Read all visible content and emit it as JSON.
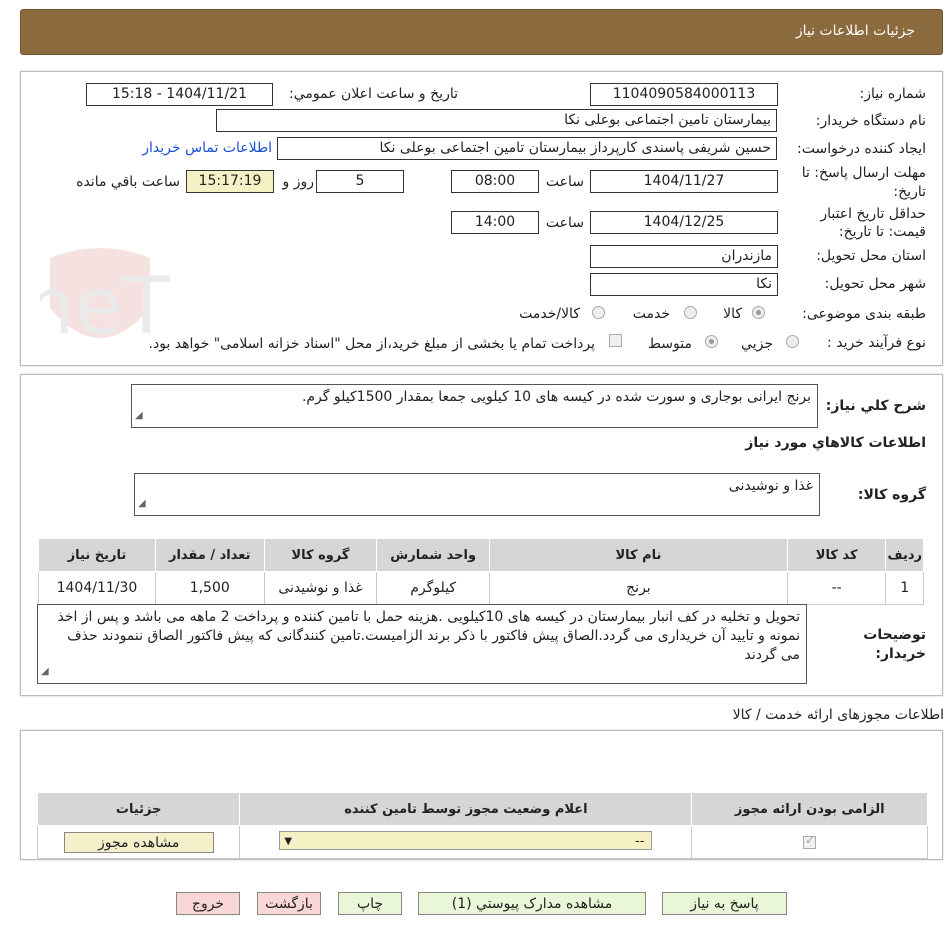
{
  "header_title": "جزئیات اطلاعات نیاز",
  "watermark": "AriaTender.neT",
  "fields": {
    "need_number_label": "شماره نیاز:",
    "need_number": "1104090584000113",
    "announce_label": "تاریخ و ساعت اعلان عمومي:",
    "announce_value": "1404/11/21 - 15:18",
    "buyer_label": "نام دستگاه خریدار:",
    "buyer_value": "بیمارستان تامین اجتماعی بوعلی نکا",
    "creator_label": "ایجاد کننده درخواست:",
    "creator_value": "حسین شریفی پاسندی کارپرداز بیمارستان تامین اجتماعی بوعلی نکا",
    "contact_link": "اطلاعات تماس خریدار",
    "deadline_label_1": "مهلت ارسال پاسخ: تا",
    "deadline_label_2": "تاریخ:",
    "deadline_date": "1404/11/27",
    "time_label": "ساعت",
    "deadline_time": "08:00",
    "days_value": "5",
    "days_label": "روز و",
    "remaining_time": "15:17:19",
    "remaining_label": "ساعت باقي مانده",
    "validity_label_1": "حداقل تاریخ اعتبار",
    "validity_label_2": "قیمت: تا تاریخ:",
    "validity_date": "1404/12/25",
    "validity_time": "14:00",
    "province_label": "استان محل تحویل:",
    "province_value": "مازندران",
    "city_label": "شهر محل تحویل:",
    "city_value": "نکا",
    "category_label": "طبقه بندی موضوعی:",
    "category_options": [
      "کالا",
      "خدمت",
      "کالا/خدمت"
    ],
    "process_label": "نوع فرآیند خرید :",
    "process_options": [
      "جزیي",
      "متوسط"
    ],
    "payment_note": "پرداخت تمام یا بخشی از مبلغ خرید،از محل \"اسناد خزانه اسلامی\" خواهد بود."
  },
  "summary": {
    "label": "شرح كلي نياز:",
    "text": "برنج ایرانی بوجاری و سورت شده در کیسه های 10 کیلویی جمعا بمقدار 1500کیلو گرم.",
    "goods_info_title": "اطلاعات کالاهاي مورد نياز",
    "group_label": "گروه کالا:",
    "group_value": "غذا و نوشیدنی"
  },
  "goods_table": {
    "headers": [
      "ردیف",
      "کد کالا",
      "نام کالا",
      "واحد شمارش",
      "گروه کالا",
      "تعداد / مقدار",
      "تاریخ نیاز"
    ],
    "rows": [
      [
        "1",
        "--",
        "برنج",
        "کیلوگرم",
        "غذا و نوشیدنی",
        "1,500",
        "1404/11/30"
      ]
    ]
  },
  "buyer_notes": {
    "label_1": "توضیحات",
    "label_2": "خریدار:",
    "text": "تحویل و تخلیه در کف انبار بیمارستان در کیسه های 10کیلویی .هزینه حمل با تامین کننده و پرداخت 2 ماهه می باشد و پس از اخذ نمونه و تایید آن خریداری می گردد.الصاق پیش فاکتور با ذکر برند الزامیست.تامین کنندگانی که پیش فاکتور الصاق ننمودند حذف می گردند"
  },
  "permits": {
    "title": "اطلاعات مجوزهای ارائه خدمت / کالا",
    "headers": [
      "الزامی بودن ارائه مجوز",
      "اعلام وضعیت مجوز توسط تامین کننده",
      "جزئیات"
    ],
    "select_value": "--",
    "view_button": "مشاهده مجوز"
  },
  "buttons": {
    "reply": "پاسخ به نیاز",
    "attachments": "مشاهده مدارک پیوستي (1)",
    "print": "چاپ",
    "back": "بازگشت",
    "exit": "خروج"
  }
}
